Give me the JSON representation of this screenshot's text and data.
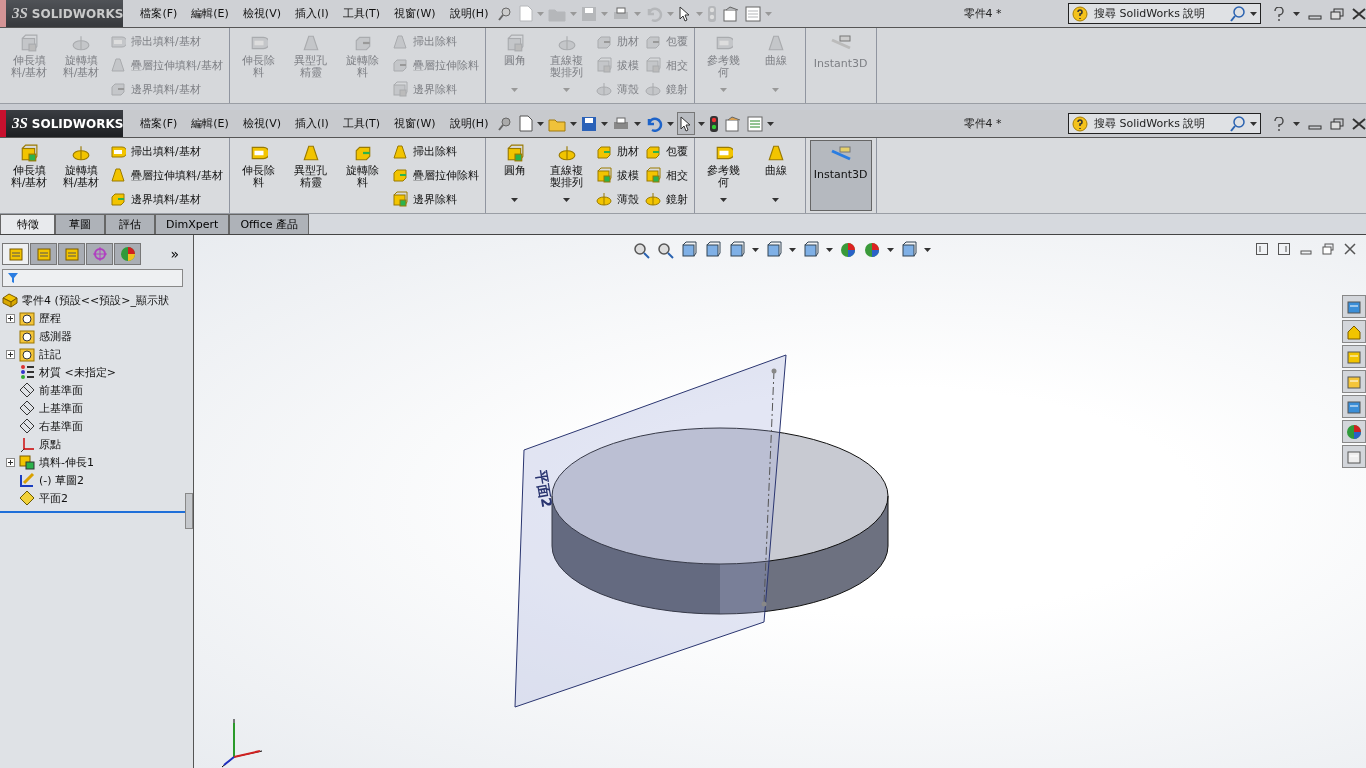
{
  "frames": [
    {
      "disabled": true,
      "logo": {
        "mark": "3S",
        "name": "SOLIDWORKS"
      },
      "menu": [
        "檔案(F)",
        "編輯(E)",
        "檢視(V)",
        "插入(I)",
        "工具(T)",
        "視窗(W)",
        "說明(H)"
      ],
      "title": "零件4 *",
      "search": {
        "placeholder": "搜尋 SolidWorks 說明"
      },
      "ribbon": [
        [
          {
            "kind": "large",
            "label": "伸長填料/基材",
            "dropdown": false,
            "pressed": false
          },
          {
            "kind": "large",
            "label": "旋轉填料/基材",
            "dropdown": false,
            "pressed": false
          },
          {
            "kind": "small",
            "items": [
              "掃出填料/基材",
              "疊層拉伸填料/基材",
              "邊界填料/基材"
            ]
          }
        ],
        [
          {
            "kind": "large",
            "label": "伸長除料",
            "dropdown": false,
            "pressed": false
          },
          {
            "kind": "large",
            "label": "異型孔精靈",
            "dropdown": false,
            "pressed": false
          },
          {
            "kind": "large",
            "label": "旋轉除料",
            "dropdown": false,
            "pressed": false
          },
          {
            "kind": "small",
            "items": [
              "掃出除料",
              "疊層拉伸除料",
              "邊界除料"
            ]
          }
        ],
        [
          {
            "kind": "large",
            "label": "圓角",
            "dropdown": true,
            "pressed": false
          },
          {
            "kind": "large",
            "label": "直線複製排列",
            "dropdown": true,
            "pressed": false
          },
          {
            "kind": "small",
            "items": [
              "肋材",
              "拔模",
              "薄殼"
            ]
          },
          {
            "kind": "small",
            "items": [
              "包覆",
              "相交",
              "鏡射"
            ]
          }
        ],
        [
          {
            "kind": "large",
            "label": "參考幾何",
            "dropdown": true,
            "pressed": false
          },
          {
            "kind": "large",
            "label": "曲線",
            "dropdown": true,
            "pressed": false
          }
        ],
        [
          {
            "kind": "wide",
            "label": "Instant3D",
            "dropdown": false,
            "pressed": false
          }
        ]
      ]
    },
    {
      "disabled": false,
      "logo": {
        "mark": "3S",
        "name": "SOLIDWORKS"
      },
      "menu": [
        "檔案(F)",
        "編輯(E)",
        "檢視(V)",
        "插入(I)",
        "工具(T)",
        "視窗(W)",
        "說明(H)"
      ],
      "title": "零件4 *",
      "search": {
        "placeholder": "搜尋 SolidWorks 說明"
      },
      "ribbon": [
        [
          {
            "kind": "large",
            "label": "伸長填料/基材",
            "dropdown": false,
            "pressed": false
          },
          {
            "kind": "large",
            "label": "旋轉填料/基材",
            "dropdown": false,
            "pressed": false
          },
          {
            "kind": "small",
            "items": [
              "掃出填料/基材",
              "疊層拉伸填料/基材",
              "邊界填料/基材"
            ]
          }
        ],
        [
          {
            "kind": "large",
            "label": "伸長除料",
            "dropdown": false,
            "pressed": false
          },
          {
            "kind": "large",
            "label": "異型孔精靈",
            "dropdown": false,
            "pressed": false
          },
          {
            "kind": "large",
            "label": "旋轉除料",
            "dropdown": false,
            "pressed": false
          },
          {
            "kind": "small",
            "items": [
              "掃出除料",
              "疊層拉伸除料",
              "邊界除料"
            ]
          }
        ],
        [
          {
            "kind": "large",
            "label": "圓角",
            "dropdown": true,
            "pressed": false
          },
          {
            "kind": "large",
            "label": "直線複製排列",
            "dropdown": true,
            "pressed": false
          },
          {
            "kind": "small",
            "items": [
              "肋材",
              "拔模",
              "薄殼"
            ]
          },
          {
            "kind": "small",
            "items": [
              "包覆",
              "相交",
              "鏡射"
            ]
          }
        ],
        [
          {
            "kind": "large",
            "label": "參考幾何",
            "dropdown": true,
            "pressed": false
          },
          {
            "kind": "large",
            "label": "曲線",
            "dropdown": true,
            "pressed": false
          }
        ],
        [
          {
            "kind": "wide",
            "label": "Instant3D",
            "dropdown": false,
            "pressed": true
          }
        ]
      ]
    }
  ],
  "command_tabs": [
    {
      "label": "特徵",
      "selected": true
    },
    {
      "label": "草圖",
      "selected": false
    },
    {
      "label": "評估",
      "selected": false
    },
    {
      "label": "DimXpert",
      "selected": false
    },
    {
      "label": "Office 產品",
      "selected": false
    }
  ],
  "manager": {
    "tabs": [
      {
        "selected": true
      },
      {
        "selected": false
      },
      {
        "selected": false
      },
      {
        "selected": false
      },
      {
        "selected": false
      }
    ],
    "more": "»",
    "tree": {
      "kind": "part",
      "label": "零件4 (預設<<預設>_顯示狀",
      "children": [
        {
          "kind": "history",
          "label": "歷程",
          "collapsed": true
        },
        {
          "kind": "sensor",
          "label": "感測器",
          "collapsed": false
        },
        {
          "kind": "annotation",
          "label": "註記",
          "collapsed": true
        },
        {
          "kind": "material",
          "label": "材質 <未指定>",
          "collapsed": false
        },
        {
          "kind": "plane",
          "label": "前基準面",
          "collapsed": false
        },
        {
          "kind": "plane",
          "label": "上基準面",
          "collapsed": false
        },
        {
          "kind": "plane",
          "label": "右基準面",
          "collapsed": false
        },
        {
          "kind": "origin",
          "label": "原點",
          "collapsed": false
        },
        {
          "kind": "extrude",
          "label": "填料-伸長1",
          "collapsed": true
        },
        {
          "kind": "sketch",
          "label": "(-) 草圖2",
          "collapsed": false
        },
        {
          "kind": "refplane",
          "label": "平面2",
          "collapsed": false
        }
      ]
    }
  },
  "viewport": {
    "plane_label": "平面2"
  }
}
